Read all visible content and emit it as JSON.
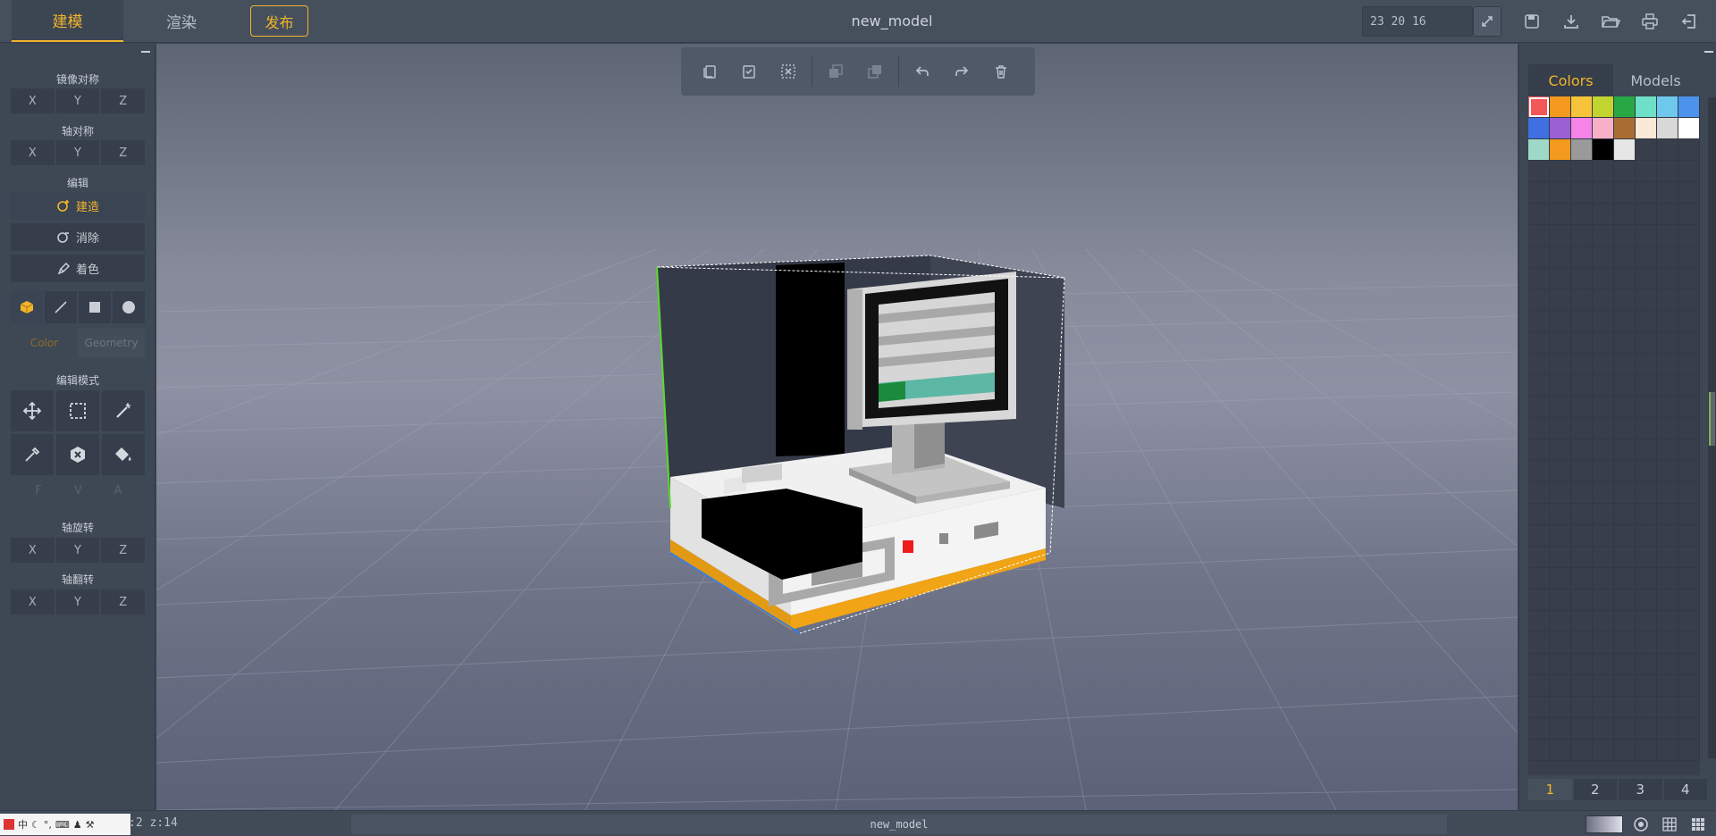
{
  "header": {
    "tabs": [
      {
        "label": "建模"
      },
      {
        "label": "渲染"
      },
      {
        "label": "发布"
      }
    ],
    "title": "new_model",
    "dimensions_value": "23 20 16"
  },
  "left_panel": {
    "mirror_label": "镜像对称",
    "axis_sym_label": "轴对称",
    "edit_label": "编辑",
    "build_label": "建造",
    "erase_label": "消除",
    "paint_label": "着色",
    "color_tab": "Color",
    "geometry_tab": "Geometry",
    "edit_mode_label": "编辑模式",
    "fva": [
      "F",
      "V",
      "A"
    ],
    "axis_rotate_label": "轴旋转",
    "axis_flip_label": "轴翻转",
    "axes": [
      "X",
      "Y",
      "Z"
    ]
  },
  "right_panel": {
    "tabs": [
      {
        "label": "Colors"
      },
      {
        "label": "Models"
      }
    ],
    "palette": [
      "#f25656",
      "#f39a1e",
      "#f7c33a",
      "#c2d42e",
      "#27a844",
      "#6fe0c8",
      "#6ec8ee",
      "#4d93ed",
      "#3f6fe0",
      "#9a5fd2",
      "#f683e8",
      "#f7b0c8",
      "#a96c33",
      "#fbe8d6",
      "#d8d8d8",
      "#ffffff",
      "#9ed8c6",
      "#f39a1e",
      "#9a9a9a",
      "#000000",
      "#e6e6e6"
    ],
    "pages": [
      "1",
      "2",
      "3",
      "4"
    ]
  },
  "status": {
    "coords": ":2  z:14",
    "model_name": "new_model",
    "ime_label": "中"
  },
  "colors": {
    "accent": "#f2b52a"
  }
}
